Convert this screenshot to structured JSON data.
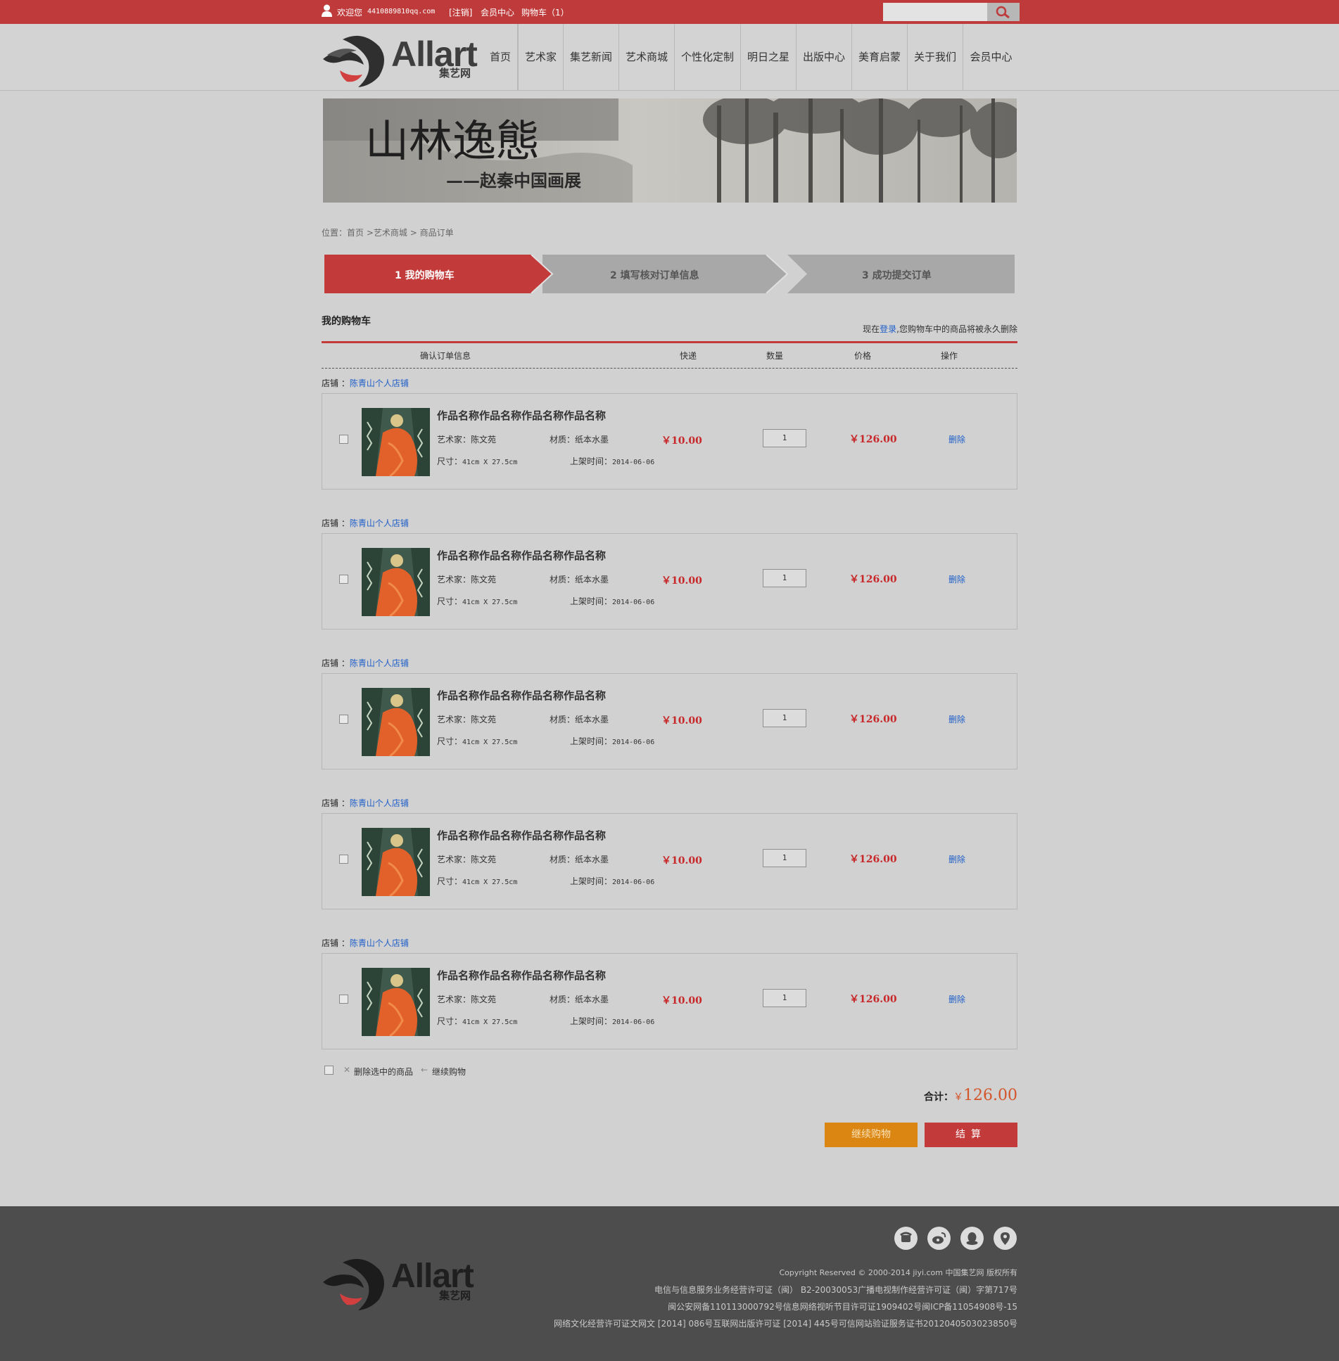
{
  "topbar": {
    "welcome": "欢迎您",
    "email": "4410889810qq.com",
    "logout": "[注销]",
    "member_center": "会员中心",
    "cart": "购物车（1）",
    "search_placeholder": ""
  },
  "logo": {
    "text": "Allart",
    "sub": "集艺网"
  },
  "nav": [
    "首页",
    "艺术家",
    "集艺新闻",
    "艺术商城",
    "个性化定制",
    "明日之星",
    "出版中心",
    "美育启蒙",
    "关于我们",
    "会员中心"
  ],
  "banner": {
    "title": "山林逸態",
    "subtitle": "——赵秦中国画展"
  },
  "breadcrumb": {
    "prefix": "位置：",
    "home": "首页",
    "sep1": ">",
    "mall": "艺术商城",
    "sep2": ">",
    "current": "商品订单"
  },
  "steps": [
    {
      "label": "1  我的购物车",
      "active": true
    },
    {
      "label": "2  填写核对订单信息",
      "active": false
    },
    {
      "label": "3  成功提交订单",
      "active": false
    }
  ],
  "cart": {
    "title": "我的购物车",
    "note_prefix": "现在",
    "note_link": "登录",
    "note_suffix": ",您购物车中的商品将被永久删除",
    "columns": {
      "info": "确认订单信息",
      "shipping": "快递",
      "qty": "数量",
      "price": "价格",
      "action": "操作"
    },
    "store_label": "店铺 ：",
    "items": [
      {
        "store": "陈青山个人店铺",
        "title": "作品名称作品名称作品名称作品名称",
        "artist_label": "艺术家：",
        "artist": "陈文苑",
        "material_label": "材质：",
        "material": "纸本水墨",
        "size_label": "尺寸：",
        "size": "41cm X 27.5cm",
        "date_label": "上架时间：",
        "date": "2014-06-06",
        "shipping": "￥10.00",
        "qty": "1",
        "price": "￥126.00",
        "delete": "删除"
      },
      {
        "store": "陈青山个人店铺",
        "title": "作品名称作品名称作品名称作品名称",
        "artist_label": "艺术家：",
        "artist": "陈文苑",
        "material_label": "材质：",
        "material": "纸本水墨",
        "size_label": "尺寸：",
        "size": "41cm X 27.5cm",
        "date_label": "上架时间：",
        "date": "2014-06-06",
        "shipping": "￥10.00",
        "qty": "1",
        "price": "￥126.00",
        "delete": "删除"
      },
      {
        "store": "陈青山个人店铺",
        "title": "作品名称作品名称作品名称作品名称",
        "artist_label": "艺术家：",
        "artist": "陈文苑",
        "material_label": "材质：",
        "material": "纸本水墨",
        "size_label": "尺寸：",
        "size": "41cm X 27.5cm",
        "date_label": "上架时间：",
        "date": "2014-06-06",
        "shipping": "￥10.00",
        "qty": "1",
        "price": "￥126.00",
        "delete": "删除"
      },
      {
        "store": "陈青山个人店铺",
        "title": "作品名称作品名称作品名称作品名称",
        "artist_label": "艺术家：",
        "artist": "陈文苑",
        "material_label": "材质：",
        "material": "纸本水墨",
        "size_label": "尺寸：",
        "size": "41cm X 27.5cm",
        "date_label": "上架时间：",
        "date": "2014-06-06",
        "shipping": "￥10.00",
        "qty": "1",
        "price": "￥126.00",
        "delete": "删除"
      },
      {
        "store": "陈青山个人店铺",
        "title": "作品名称作品名称作品名称作品名称",
        "artist_label": "艺术家：",
        "artist": "陈文苑",
        "material_label": "材质：",
        "material": "纸本水墨",
        "size_label": "尺寸：",
        "size": "41cm X 27.5cm",
        "date_label": "上架时间：",
        "date": "2014-06-06",
        "shipping": "￥10.00",
        "qty": "1",
        "price": "￥126.00",
        "delete": "删除"
      }
    ],
    "delete_selected": "删除选中的商品",
    "continue_link": "继续购物",
    "total_label": "合计：",
    "total_currency": "￥",
    "total_amount": "126.00",
    "btn_continue": "继续购物",
    "btn_settle": "结算"
  },
  "footer": {
    "logo_text": "Allart",
    "logo_sub": "集艺网",
    "social_icons": [
      "phone-icon",
      "weibo-icon",
      "qq-icon",
      "location-icon"
    ],
    "lines": [
      "Copyright Reserved © 2000-2014 jiyi.com 中国集艺网 版权所有",
      "电信与信息服务业务经营许可证（闽） B2-20030053广播电视制作经营许可证（闽）字第717号",
      "闽公安网备110113000792号信息网络视听节目许可证1909402号闽ICP备11054908号-15",
      "网络文化经营许可证文网文 [2014] 086号互联网出版许可证 [2014] 445号可信网站验证服务证书2012040503023850号"
    ]
  },
  "colors": {
    "brand_red": "#bf3b3b",
    "price_red": "#c8282a",
    "link_blue": "#1f5fc9",
    "orange": "#db8612",
    "footer_bg": "#4e4d4d"
  }
}
